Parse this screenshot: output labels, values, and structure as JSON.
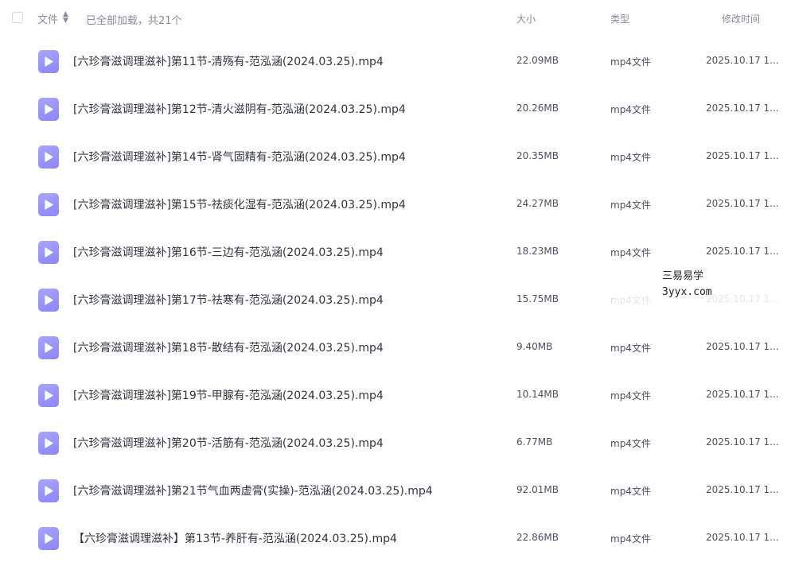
{
  "header": {
    "name_label": "文件",
    "status": "已全部加载，共21个",
    "size_label": "大小",
    "type_label": "类型",
    "time_label": "修改时间"
  },
  "files": [
    {
      "name": "[六珍膏滋调理滋补]第11节-清殇有-范泓涵(2024.03.25).mp4",
      "size": "22.09MB",
      "type": "mp4文件",
      "time": "2025.10.17 1..."
    },
    {
      "name": "[六珍膏滋调理滋补]第12节-清火滋阴有-范泓涵(2024.03.25).mp4",
      "size": "20.26MB",
      "type": "mp4文件",
      "time": "2025.10.17 1..."
    },
    {
      "name": "[六珍膏滋调理滋补]第14节-肾气固精有-范泓涵(2024.03.25).mp4",
      "size": "20.35MB",
      "type": "mp4文件",
      "time": "2025.10.17 1..."
    },
    {
      "name": "[六珍膏滋调理滋补]第15节-祛痰化湿有-范泓涵(2024.03.25).mp4",
      "size": "24.27MB",
      "type": "mp4文件",
      "time": "2025.10.17 1..."
    },
    {
      "name": "[六珍膏滋调理滋补]第16节-三边有-范泓涵(2024.03.25).mp4",
      "size": "18.23MB",
      "type": "mp4文件",
      "time": "2025.10.17 1..."
    },
    {
      "name": "[六珍膏滋调理滋补]第17节-祛寒有-范泓涵(2024.03.25).mp4",
      "size": "15.75MB",
      "type": "mp4文件",
      "time": "2025.10.17 1..."
    },
    {
      "name": "[六珍膏滋调理滋补]第18节-散结有-范泓涵(2024.03.25).mp4",
      "size": "9.40MB",
      "type": "mp4文件",
      "time": "2025.10.17 1..."
    },
    {
      "name": "[六珍膏滋调理滋补]第19节-甲腺有-范泓涵(2024.03.25).mp4",
      "size": "10.14MB",
      "type": "mp4文件",
      "time": "2025.10.17 1..."
    },
    {
      "name": "[六珍膏滋调理滋补]第20节-活筋有-范泓涵(2024.03.25).mp4",
      "size": "6.77MB",
      "type": "mp4文件",
      "time": "2025.10.17 1..."
    },
    {
      "name": "[六珍膏滋调理滋补]第21节气血两虚膏(实操)-范泓涵(2024.03.25).mp4",
      "size": "92.01MB",
      "type": "mp4文件",
      "time": "2025.10.17 1..."
    },
    {
      "name": "【六珍膏滋调理滋补】第13节-养肝有-范泓涵(2024.03.25).mp4",
      "size": "22.86MB",
      "type": "mp4文件",
      "time": "2025.10.17 1..."
    }
  ],
  "watermark": {
    "line1": "三易易学",
    "line2": "3yyx.com"
  },
  "colors": {
    "icon_accent": "#9b95fb"
  }
}
